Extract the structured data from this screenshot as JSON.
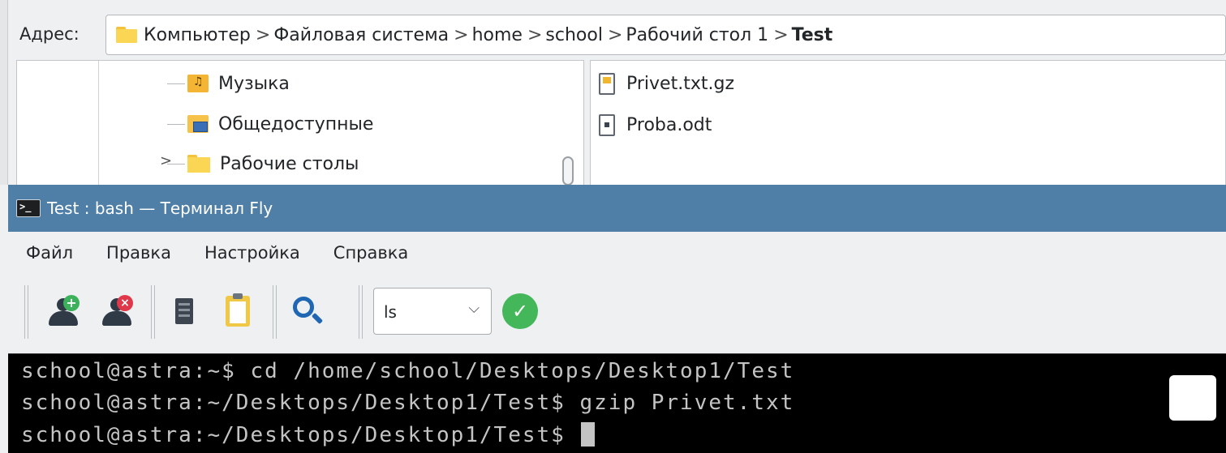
{
  "file_manager": {
    "address_label": "Адрес:",
    "breadcrumbs": [
      "Компьютер",
      "Файловая система",
      "home",
      "school",
      "Рабочий стол 1",
      "Test"
    ],
    "breadcrumb_sep": ">",
    "tree_items": [
      {
        "label": "Музыка",
        "icon": "music-folder-icon"
      },
      {
        "label": "Общедоступные",
        "icon": "public-folder-icon"
      },
      {
        "label": "Рабочие столы",
        "icon": "folder-icon"
      }
    ],
    "files": [
      {
        "label": "Privet.txt.gz",
        "icon": "archive-file-icon"
      },
      {
        "label": "Proba.odt",
        "icon": "document-file-icon"
      }
    ]
  },
  "terminal": {
    "window_title": "Test : bash — Терминал Fly",
    "menu": [
      "Файл",
      "Правка",
      "Настройка",
      "Справка"
    ],
    "toolbar": {
      "command_combo_value": "ls",
      "icons": [
        "add-user-icon",
        "remove-user-icon",
        "copy-icon",
        "paste-icon",
        "search-icon",
        "confirm-icon"
      ]
    },
    "lines": [
      "school@astra:~$ cd /home/school/Desktops/Desktop1/Test",
      "school@astra:~/Desktops/Desktop1/Test$ gzip Privet.txt",
      "school@astra:~/Desktops/Desktop1/Test$ "
    ]
  },
  "colors": {
    "titlebar": "#4f7ea6",
    "console_bg": "#000000",
    "console_fg": "#c4c4c4",
    "folder": "#fbd554",
    "confirm": "#43b75a"
  }
}
